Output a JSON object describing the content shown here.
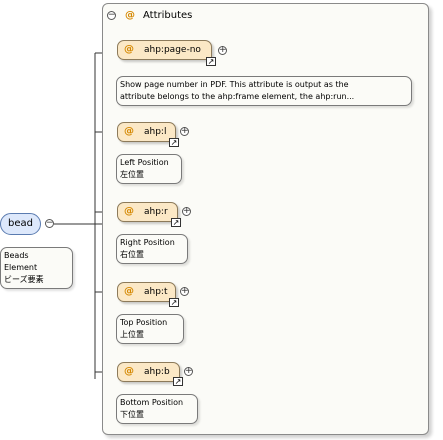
{
  "group": {
    "title": "Attributes"
  },
  "element": {
    "name": "bead",
    "doc": [
      "Beads",
      "Element",
      "ビーズ要素"
    ]
  },
  "attributes": [
    {
      "name": "ahp:page-no",
      "doc": [
        "Show page number in PDF. This attribute is output as the",
        "attribute belongs to the ahp:frame element, the ahp:run..."
      ]
    },
    {
      "name": "ahp:l",
      "doc": [
        "Left Position",
        "左位置"
      ]
    },
    {
      "name": "ahp:r",
      "doc": [
        "Right Position",
        "右位置"
      ]
    },
    {
      "name": "ahp:t",
      "doc": [
        "Top Position",
        "上位置"
      ]
    },
    {
      "name": "ahp:b",
      "doc": [
        "Bottom Position",
        "下位置"
      ]
    }
  ],
  "icons": {
    "attribute": "at-sign-icon",
    "collapse": "minus-circle-icon",
    "expand": "plus-circle-icon",
    "reference": "link-arrow-icon"
  },
  "colors": {
    "attribute_fill": "#fbe8c6",
    "element_fill": "#dde8fb",
    "attribute_marker": "#d48700"
  }
}
